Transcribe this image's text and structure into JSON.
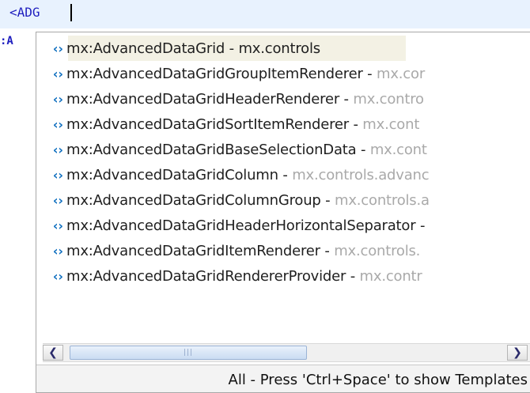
{
  "editor": {
    "typed_text": "<ADG",
    "gutter_text": ":A"
  },
  "popup": {
    "items": [
      {
        "icon": "tag-icon",
        "name": "mx:AdvancedDataGrid",
        "sep": " - ",
        "pkg": "mx.controls",
        "selected": true
      },
      {
        "icon": "tag-icon",
        "name": "mx:AdvancedDataGridGroupItemRenderer",
        "sep": " - ",
        "pkg": "mx.cor",
        "selected": false
      },
      {
        "icon": "tag-icon",
        "name": "mx:AdvancedDataGridHeaderRenderer",
        "sep": " - ",
        "pkg": "mx.contro",
        "selected": false
      },
      {
        "icon": "tag-icon",
        "name": "mx:AdvancedDataGridSortItemRenderer",
        "sep": " - ",
        "pkg": "mx.cont",
        "selected": false
      },
      {
        "icon": "tag-icon",
        "name": "mx:AdvancedDataGridBaseSelectionData",
        "sep": " - ",
        "pkg": "mx.cont",
        "selected": false
      },
      {
        "icon": "tag-icon",
        "name": "mx:AdvancedDataGridColumn",
        "sep": " - ",
        "pkg": "mx.controls.advanc",
        "selected": false
      },
      {
        "icon": "tag-icon",
        "name": "mx:AdvancedDataGridColumnGroup",
        "sep": " - ",
        "pkg": "mx.controls.a",
        "selected": false
      },
      {
        "icon": "tag-icon",
        "name": "mx:AdvancedDataGridHeaderHorizontalSeparator",
        "sep": " -",
        "pkg": "",
        "selected": false
      },
      {
        "icon": "tag-icon",
        "name": "mx:AdvancedDataGridItemRenderer",
        "sep": " - ",
        "pkg": "mx.controls.",
        "selected": false
      },
      {
        "icon": "tag-icon",
        "name": "mx:AdvancedDataGridRendererProvider",
        "sep": " - ",
        "pkg": "mx.contr",
        "selected": false
      }
    ],
    "scrollbar": {
      "left_icon": "chevron-left-icon",
      "right_icon": "chevron-right-icon"
    },
    "status_text": "All - Press 'Ctrl+Space' to show Templates"
  },
  "colors": {
    "editor_line_bg": "#e8f2fe",
    "code_text": "#1f1fbf",
    "selection_bg": "#f3f1e4",
    "package_text": "#a9a9a9",
    "tag_icon": "#0f6fbf"
  }
}
